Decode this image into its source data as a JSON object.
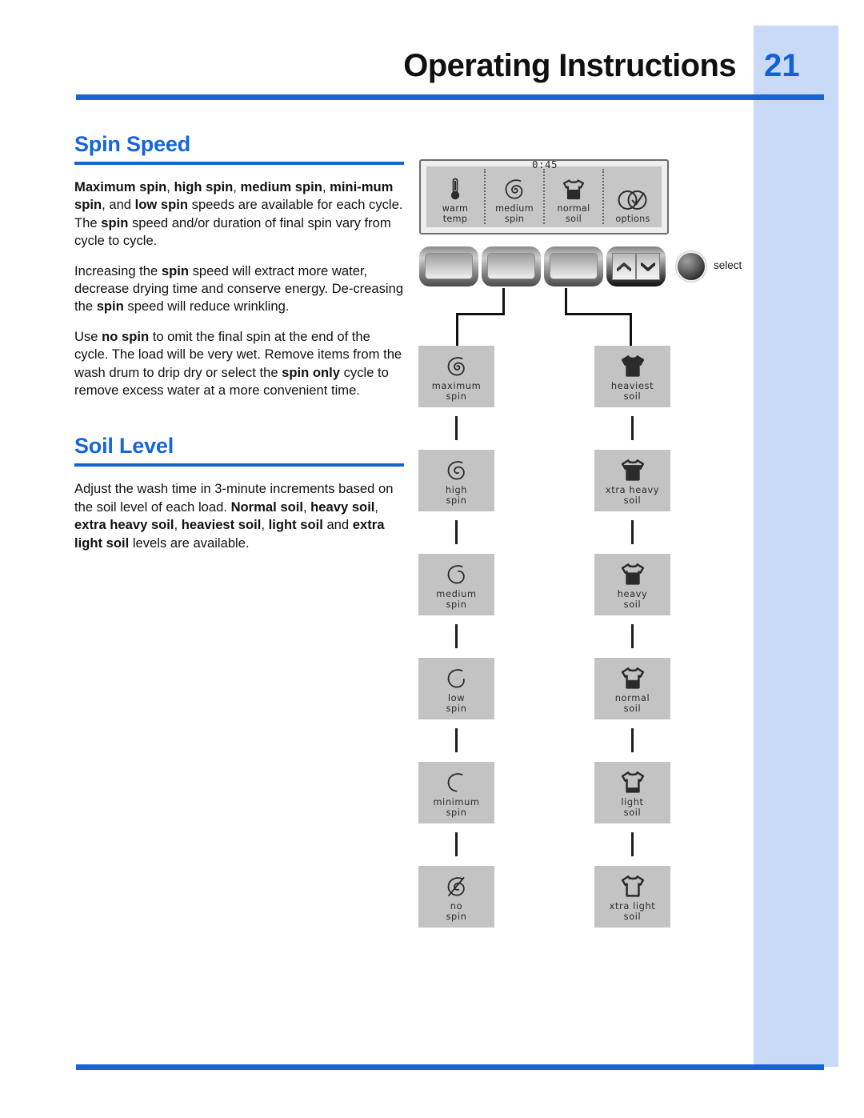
{
  "header": {
    "title": "Operating Instructions",
    "page_number": "21",
    "accent_color": "#1663d4",
    "band_color": "#c9daf8"
  },
  "sections": [
    {
      "heading": "Spin Speed",
      "paragraphs": [
        [
          {
            "t": "Maximum spin",
            "b": true
          },
          {
            "t": ", ",
            "b": false
          },
          {
            "t": "high spin",
            "b": true
          },
          {
            "t": ", ",
            "b": false
          },
          {
            "t": "medium spin",
            "b": true
          },
          {
            "t": ", ",
            "b": false
          },
          {
            "t": "mini-mum spin",
            "b": true
          },
          {
            "t": ", and ",
            "b": false
          },
          {
            "t": "low spin",
            "b": true
          },
          {
            "t": " speeds are available for each cycle. The ",
            "b": false
          },
          {
            "t": "spin",
            "b": true
          },
          {
            "t": " speed and/or duration of final spin vary from cycle to cycle.",
            "b": false
          }
        ],
        [
          {
            "t": "Increasing the ",
            "b": false
          },
          {
            "t": "spin",
            "b": true
          },
          {
            "t": " speed will extract more water, decrease drying time and conserve energy. De-creasing the ",
            "b": false
          },
          {
            "t": "spin",
            "b": true
          },
          {
            "t": " speed will reduce wrinkling.",
            "b": false
          }
        ],
        [
          {
            "t": "Use ",
            "b": false
          },
          {
            "t": "no spin",
            "b": true
          },
          {
            "t": " to omit the final spin at the end of the cycle. The load will be very wet. Remove items from the wash drum to drip dry or select the ",
            "b": false
          },
          {
            "t": "spin only",
            "b": true
          },
          {
            "t": " cycle to remove excess water at a more convenient time.",
            "b": false
          }
        ]
      ]
    },
    {
      "heading": "Soil Level",
      "paragraphs": [
        [
          {
            "t": "Adjust the wash time in 3-minute increments based on the soil level of each load. ",
            "b": false
          },
          {
            "t": "Normal soil",
            "b": true
          },
          {
            "t": ", ",
            "b": false
          },
          {
            "t": "heavy soil",
            "b": true
          },
          {
            "t": ", ",
            "b": false
          },
          {
            "t": "extra heavy soil",
            "b": true
          },
          {
            "t": ", ",
            "b": false
          },
          {
            "t": "heaviest soil",
            "b": true
          },
          {
            "t": ", ",
            "b": false
          },
          {
            "t": "light soil",
            "b": true
          },
          {
            "t": " and ",
            "b": false
          },
          {
            "t": "extra light soil",
            "b": true
          },
          {
            "t": " levels are available.",
            "b": false
          }
        ]
      ]
    }
  ],
  "diagram": {
    "display_panel": {
      "time": "0:45",
      "cells": [
        {
          "icon": "thermometer-icon",
          "line1": "warm",
          "line2": "temp"
        },
        {
          "icon": "spiral-spin-icon",
          "line1": "medium",
          "line2": "spin"
        },
        {
          "icon": "tshirt-soil-icon",
          "line1": "normal",
          "line2": "soil"
        },
        {
          "icon": "options-check-icon",
          "line1": "options",
          "line2": ""
        }
      ]
    },
    "buttons": {
      "blank_buttons": 3,
      "arrow_up": "chevron-up-icon",
      "arrow_down": "chevron-down-icon",
      "select_label": "select"
    },
    "spin_column": [
      {
        "icon": "spin-maximum-icon",
        "line1": "maximum",
        "line2": "spin"
      },
      {
        "icon": "spin-high-icon",
        "line1": "high",
        "line2": "spin"
      },
      {
        "icon": "spin-medium-icon",
        "line1": "medium",
        "line2": "spin"
      },
      {
        "icon": "spin-low-icon",
        "line1": "low",
        "line2": "spin"
      },
      {
        "icon": "spin-minimum-icon",
        "line1": "minimum",
        "line2": "spin"
      },
      {
        "icon": "spin-none-icon",
        "line1": "no",
        "line2": "spin"
      }
    ],
    "soil_column": [
      {
        "icon": "soil-heaviest-icon",
        "line1": "heaviest",
        "line2": "soil",
        "fill": 0.96
      },
      {
        "icon": "soil-xtra-heavy-icon",
        "line1": "xtra heavy",
        "line2": "soil",
        "fill": 0.76
      },
      {
        "icon": "soil-heavy-icon",
        "line1": "heavy",
        "line2": "soil",
        "fill": 0.58
      },
      {
        "icon": "soil-normal-icon",
        "line1": "normal",
        "line2": "soil",
        "fill": 0.4
      },
      {
        "icon": "soil-light-icon",
        "line1": "light",
        "line2": "soil",
        "fill": 0.22
      },
      {
        "icon": "soil-xtra-light-icon",
        "line1": "xtra light",
        "line2": "soil",
        "fill": 0.0
      }
    ]
  }
}
